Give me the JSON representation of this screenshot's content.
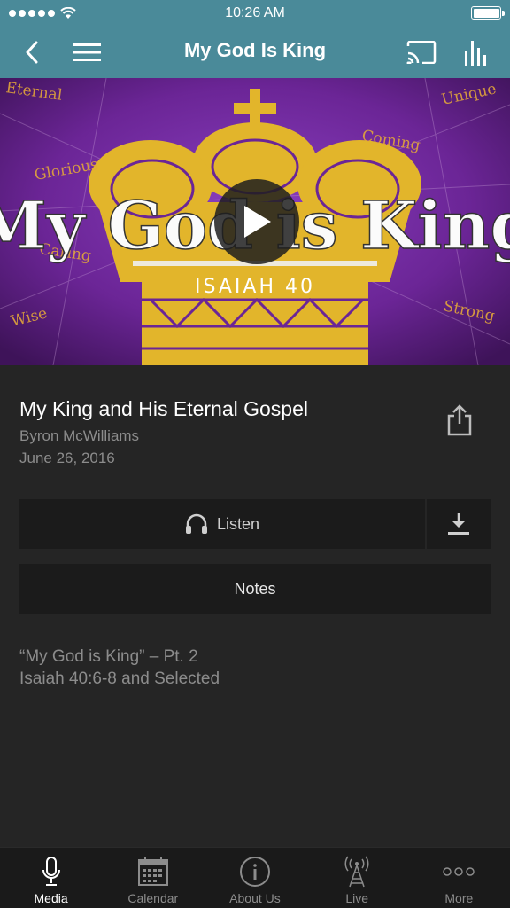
{
  "status_bar": {
    "time": "10:26 AM"
  },
  "nav": {
    "title": "My God Is King"
  },
  "hero": {
    "art_title": "My God is King",
    "art_subtitle": "ISAIAH 40",
    "words": [
      "Eternal",
      "Unique",
      "Glorious",
      "Coming",
      "Caring",
      "Wise",
      "Strong"
    ]
  },
  "media": {
    "title": "My King and His Eternal Gospel",
    "speaker": "Byron McWilliams",
    "date": "June 26, 2016",
    "listen_label": "Listen",
    "notes_label": "Notes",
    "description_line1": "“My God is King” – Pt. 2",
    "description_line2": "Isaiah 40:6-8 and Selected"
  },
  "tabs": [
    {
      "label": "Media",
      "icon": "microphone-icon",
      "active": true
    },
    {
      "label": "Calendar",
      "icon": "calendar-icon",
      "active": false
    },
    {
      "label": "About Us",
      "icon": "info-icon",
      "active": false
    },
    {
      "label": "Live",
      "icon": "broadcast-tower-icon",
      "active": false
    },
    {
      "label": "More",
      "icon": "more-dots-icon",
      "active": false
    }
  ],
  "colors": {
    "nav_bg": "#4a8a99",
    "content_bg": "#252525",
    "button_bg": "#1b1b1b",
    "tab_bg": "#1a1a1a"
  }
}
